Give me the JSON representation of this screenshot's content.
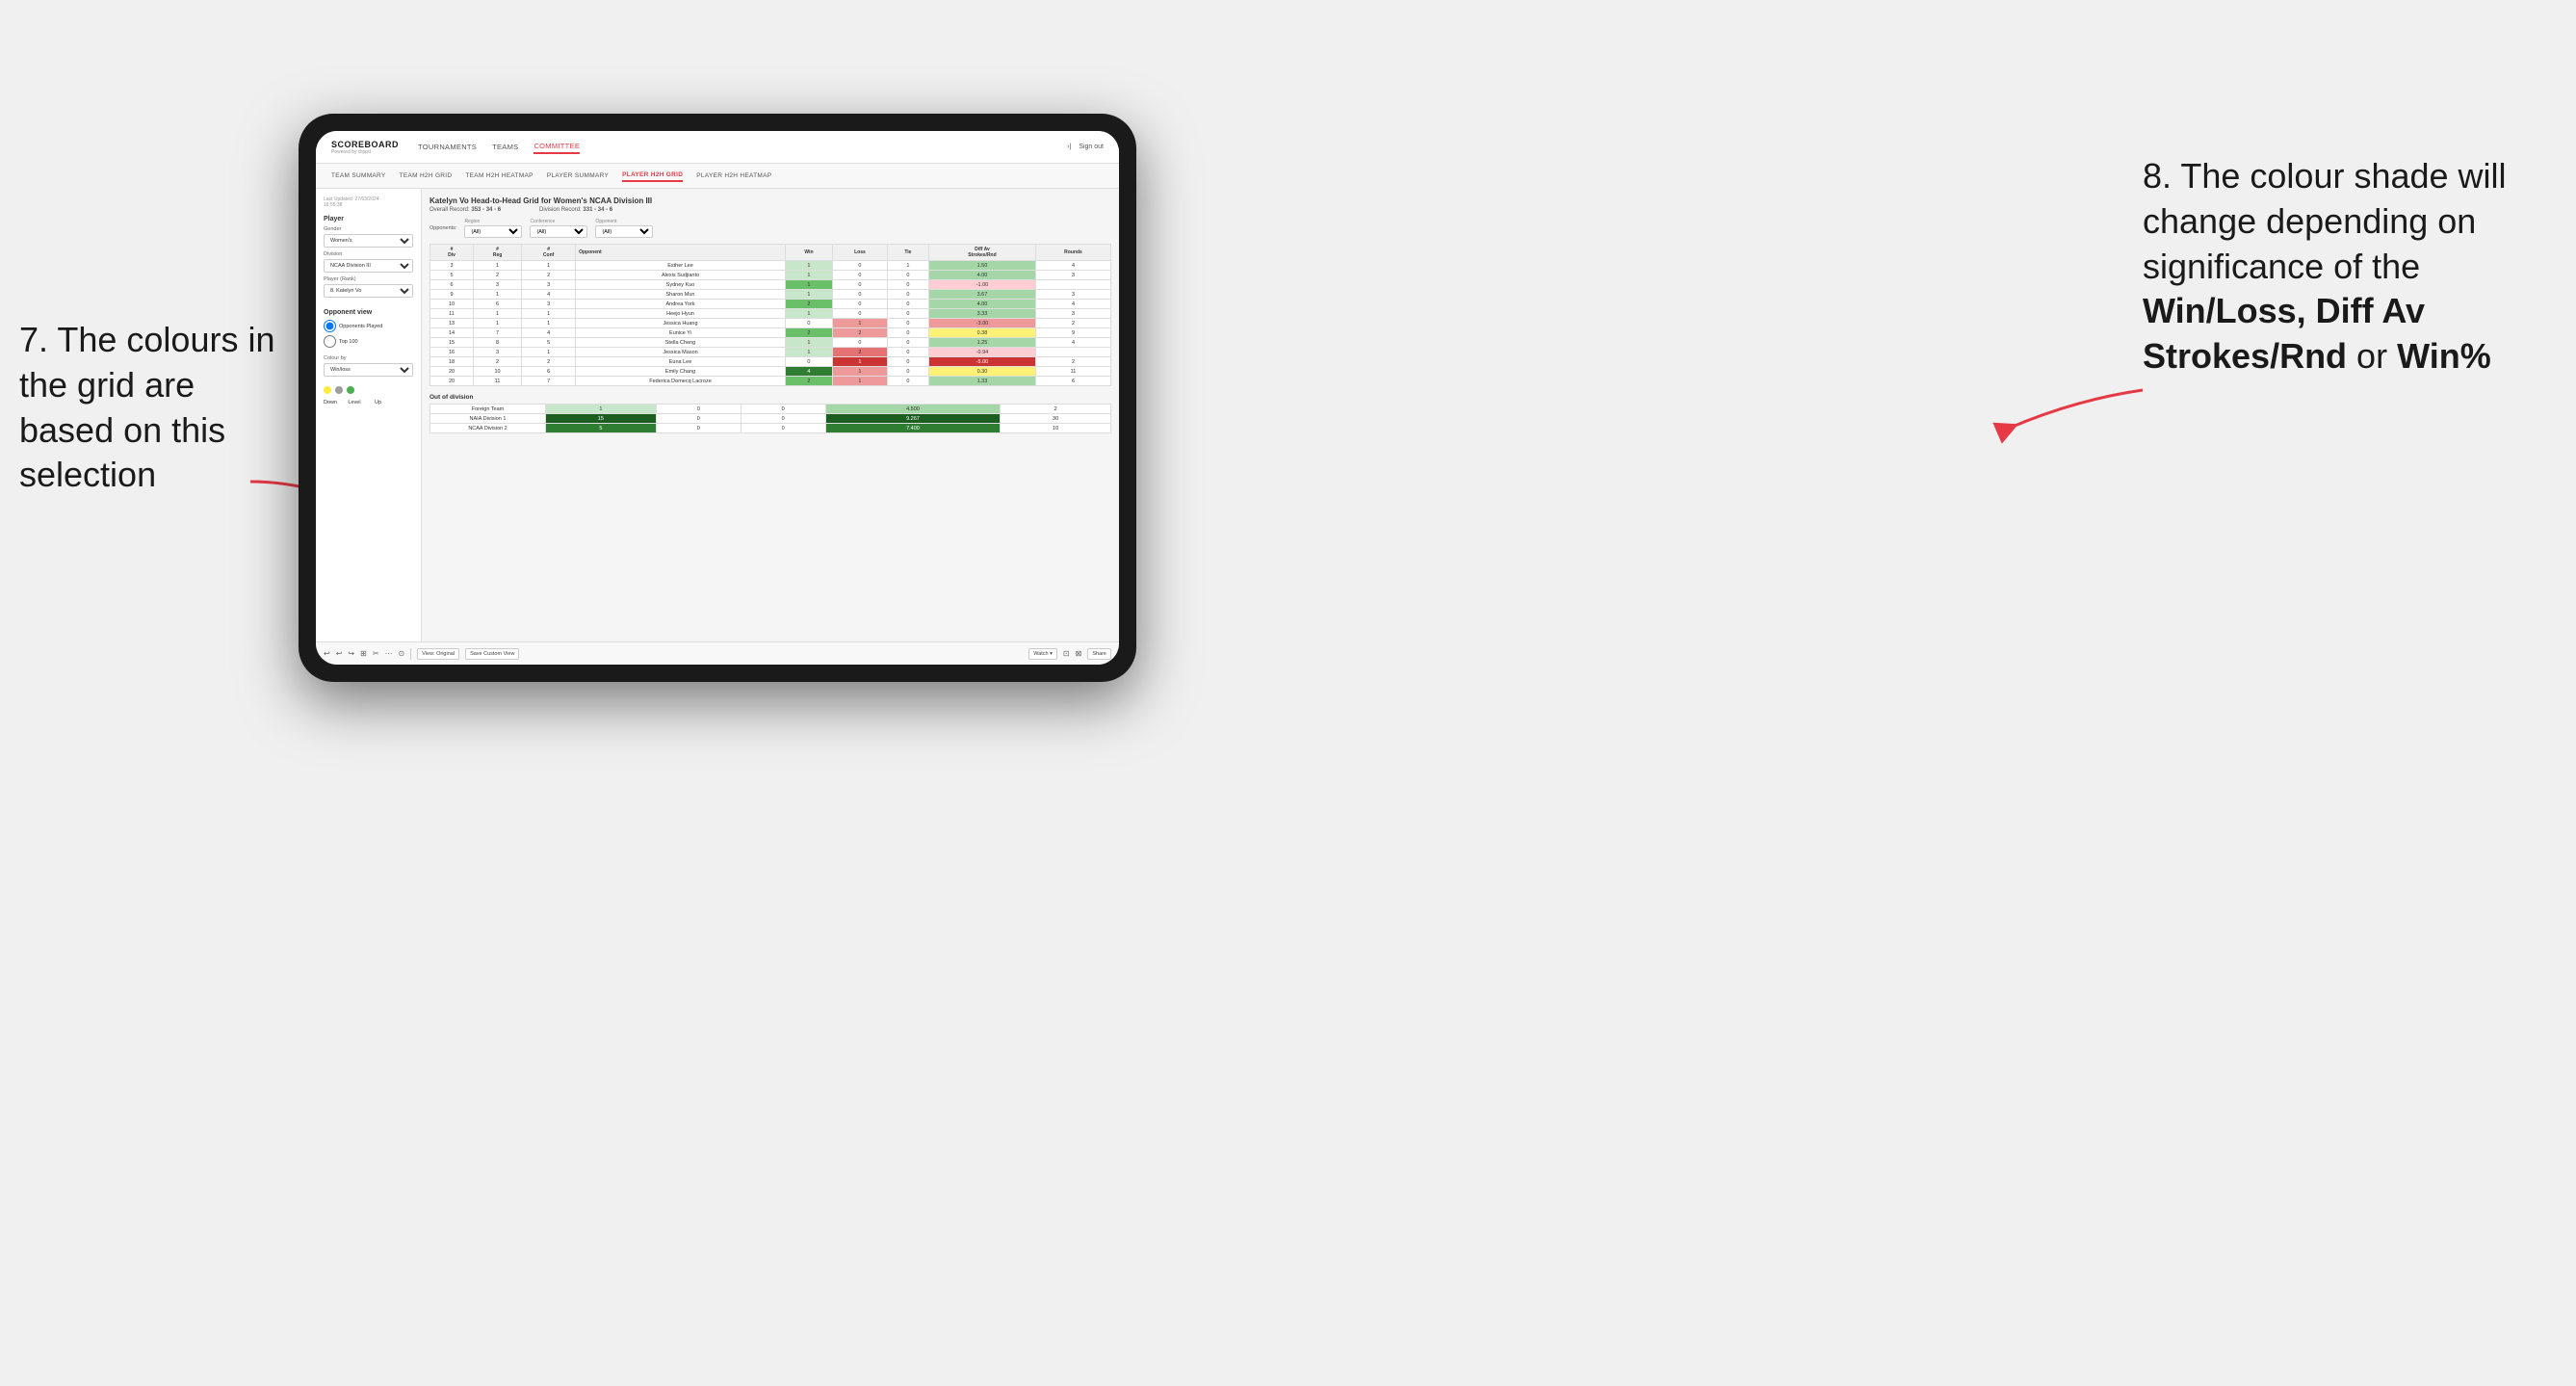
{
  "page": {
    "background": "#f0f0f0"
  },
  "annotation_left": {
    "text": "7. The colours in the grid are based on this selection"
  },
  "annotation_right": {
    "line1": "8. The colour shade will change depending on significance of the",
    "bold1": "Win/Loss, Diff Av Strokes/Rnd",
    "line2": "or",
    "bold2": "Win%"
  },
  "nav": {
    "logo": "SCOREBOARD",
    "logo_sub": "Powered by clippd",
    "links": [
      "TOURNAMENTS",
      "TEAMS",
      "COMMITTEE"
    ],
    "active_link": "COMMITTEE",
    "sign_in_icon": "›|",
    "sign_out": "Sign out"
  },
  "sub_nav": {
    "links": [
      "TEAM SUMMARY",
      "TEAM H2H GRID",
      "TEAM H2H HEATMAP",
      "PLAYER SUMMARY",
      "PLAYER H2H GRID",
      "PLAYER H2H HEATMAP"
    ],
    "active": "PLAYER H2H GRID"
  },
  "sidebar": {
    "timestamp_label": "Last Updated: 27/03/2024",
    "timestamp_time": "16:55:38",
    "player_section": "Player",
    "gender_label": "Gender",
    "gender_value": "Women's",
    "division_label": "Division",
    "division_value": "NCAA Division III",
    "player_rank_label": "Player (Rank)",
    "player_rank_value": "8. Katelyn Vo",
    "opponent_view_title": "Opponent view",
    "opponent_option1": "Opponents Played",
    "opponent_option2": "Top 100",
    "colour_by_label": "Colour by",
    "colour_by_value": "Win/loss",
    "legend_down": "Down",
    "legend_level": "Level",
    "legend_up": "Up"
  },
  "grid": {
    "title": "Katelyn Vo Head-to-Head Grid for Women's NCAA Division III",
    "overall_record_label": "Overall Record:",
    "overall_record_value": "353 - 34 - 6",
    "division_record_label": "Division Record:",
    "division_record_value": "331 - 34 - 6",
    "region_label": "Region",
    "region_value": "(All)",
    "conference_label": "Conference",
    "conference_value": "(All)",
    "opponent_label": "Opponent",
    "opponent_value": "(All)",
    "opponents_label": "Opponents:",
    "columns": {
      "div": "#\nDiv",
      "reg": "#\nReg",
      "conf": "#\nConf",
      "opponent": "Opponent",
      "win": "Win",
      "loss": "Loss",
      "tie": "Tie",
      "diff_av": "Diff Av\nStrokes/Rnd",
      "rounds": "Rounds"
    },
    "rows": [
      {
        "div": 3,
        "reg": 1,
        "conf": 1,
        "opponent": "Esther Lee",
        "win": 1,
        "loss": 0,
        "tie": 1,
        "diff_av": 1.5,
        "rounds": 4,
        "win_color": "light",
        "loss_color": "",
        "diff_color": "green_light"
      },
      {
        "div": 5,
        "reg": 2,
        "conf": 2,
        "opponent": "Alexis Sudjianto",
        "win": 1,
        "loss": 0,
        "tie": 0,
        "diff_av": 4.0,
        "rounds": 3,
        "win_color": "light",
        "loss_color": "",
        "diff_color": "green_medium"
      },
      {
        "div": 6,
        "reg": 3,
        "conf": 3,
        "opponent": "Sydney Kuo",
        "win": 1,
        "loss": 0,
        "tie": 0,
        "diff_av": -1.0,
        "rounds": "",
        "win_color": "medium",
        "loss_color": "",
        "diff_color": "red_light"
      },
      {
        "div": 9,
        "reg": 1,
        "conf": 4,
        "opponent": "Sharon Mun",
        "win": 1,
        "loss": 0,
        "tie": 0,
        "diff_av": 3.67,
        "rounds": 3,
        "win_color": "light",
        "loss_color": "",
        "diff_color": "green_light"
      },
      {
        "div": 10,
        "reg": 6,
        "conf": 3,
        "opponent": "Andrea York",
        "win": 2,
        "loss": 0,
        "tie": 0,
        "diff_av": 4.0,
        "rounds": 4,
        "win_color": "medium",
        "loss_color": "",
        "diff_color": "green_medium"
      },
      {
        "div": 11,
        "reg": 1,
        "conf": 1,
        "opponent": "Heejo Hyun",
        "win": 1,
        "loss": 0,
        "tie": 0,
        "diff_av": 3.33,
        "rounds": 3,
        "win_color": "light",
        "loss_color": "",
        "diff_color": "green_light"
      },
      {
        "div": 13,
        "reg": 1,
        "conf": 1,
        "opponent": "Jessica Huang",
        "win": 0,
        "loss": 1,
        "tie": 0,
        "diff_av": -3.0,
        "rounds": 2,
        "win_color": "",
        "loss_color": "red_light",
        "diff_color": "red_medium"
      },
      {
        "div": 14,
        "reg": 7,
        "conf": 4,
        "opponent": "Eunice Yi",
        "win": 2,
        "loss": 2,
        "tie": 0,
        "diff_av": 0.38,
        "rounds": 9,
        "win_color": "medium",
        "loss_color": "red_medium",
        "diff_color": "green_light"
      },
      {
        "div": 15,
        "reg": 8,
        "conf": 5,
        "opponent": "Stella Cheng",
        "win": 1,
        "loss": 0,
        "tie": 0,
        "diff_av": 1.25,
        "rounds": 4,
        "win_color": "light",
        "loss_color": "",
        "diff_color": "green_light"
      },
      {
        "div": 16,
        "reg": 3,
        "conf": 1,
        "opponent": "Jessica Mason",
        "win": 1,
        "loss": 2,
        "tie": 0,
        "diff_av": -0.94,
        "rounds": "",
        "win_color": "light",
        "loss_color": "red_medium",
        "diff_color": "red_light"
      },
      {
        "div": 18,
        "reg": 2,
        "conf": 2,
        "opponent": "Euna Lee",
        "win": 0,
        "loss": 1,
        "tie": 0,
        "diff_av": -5.0,
        "rounds": 2,
        "win_color": "",
        "loss_color": "red_dark",
        "diff_color": "red_dark"
      },
      {
        "div": 20,
        "reg": 10,
        "conf": 6,
        "opponent": "Emily Chang",
        "win": 4,
        "loss": 1,
        "tie": 0,
        "diff_av": 0.3,
        "rounds": 11,
        "win_color": "dark",
        "loss_color": "red_light",
        "diff_color": "green_light"
      },
      {
        "div": 20,
        "reg": 11,
        "conf": 7,
        "opponent": "Federica Domecq Lacroze",
        "win": 2,
        "loss": 1,
        "tie": 0,
        "diff_av": 1.33,
        "rounds": 6,
        "win_color": "medium",
        "loss_color": "red_light",
        "diff_color": "green_light"
      }
    ],
    "out_of_division_title": "Out of division",
    "out_of_division_rows": [
      {
        "name": "Foreign Team",
        "win": 1,
        "loss": 0,
        "tie": 0,
        "diff_av": 4.5,
        "rounds": 2,
        "win_color": "light",
        "diff_color": "green_medium"
      },
      {
        "name": "NAIA Division 1",
        "win": 15,
        "loss": 0,
        "tie": 0,
        "diff_av": 9.267,
        "rounds": 30,
        "win_color": "dark",
        "diff_color": "green_dark"
      },
      {
        "name": "NCAA Division 2",
        "win": 5,
        "loss": 0,
        "tie": 0,
        "diff_av": 7.4,
        "rounds": 10,
        "win_color": "dark",
        "diff_color": "green_dark"
      }
    ]
  },
  "toolbar": {
    "icons": [
      "↩",
      "↩",
      "↪",
      "⊞",
      "✂",
      "·",
      "⊙",
      "|"
    ],
    "view_original": "View: Original",
    "save_custom": "Save Custom View",
    "watch": "Watch ▾",
    "share": "Share"
  }
}
